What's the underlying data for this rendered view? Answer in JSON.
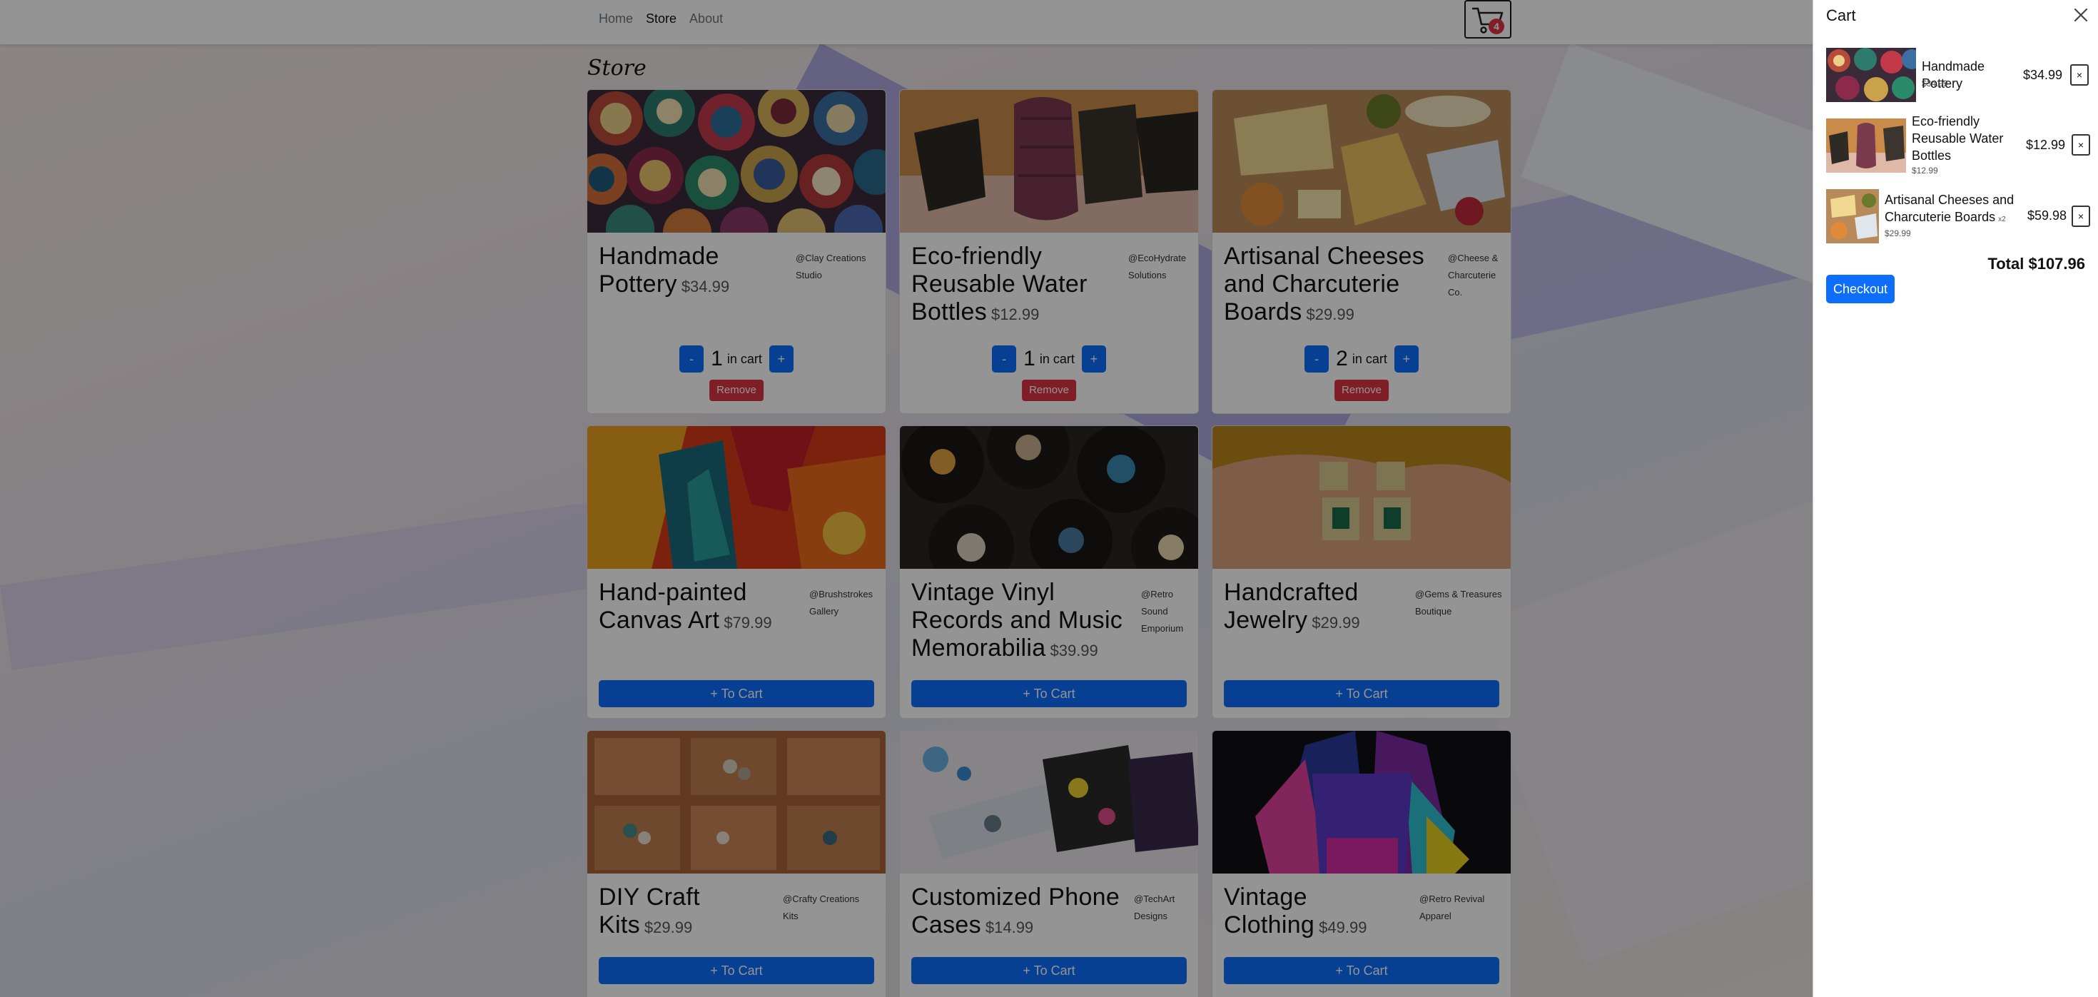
{
  "nav": {
    "links": [
      "Home",
      "Store",
      "About"
    ],
    "active": "Store",
    "cart_count": "4"
  },
  "store": {
    "title": "Store",
    "qty_suffix": "in cart",
    "remove_label": "Remove",
    "minus_label": "-",
    "plus_label": "+",
    "add_label": "+ To Cart",
    "products": [
      {
        "name": "Handmade Pottery",
        "price": "$34.99",
        "seller": "@Clay Creations Studio",
        "qty": "1"
      },
      {
        "name": "Eco-friendly Reusable Water Bottles",
        "price": "$12.99",
        "seller": "@EcoHydrate Solutions",
        "qty": "1"
      },
      {
        "name": "Artisanal Cheeses and Charcuterie Boards",
        "price": "$29.99",
        "seller": "@Cheese & Charcuterie Co.",
        "qty": "2"
      },
      {
        "name": "Hand-painted Canvas Art",
        "price": "$79.99",
        "seller": "@Brushstrokes Gallery",
        "qty": ""
      },
      {
        "name": "Vintage Vinyl Records and Music Memorabilia",
        "price": "$39.99",
        "seller": "@Retro Sound Emporium",
        "qty": ""
      },
      {
        "name": "Handcrafted Jewelry",
        "price": "$29.99",
        "seller": "@Gems & Treasures Boutique",
        "qty": ""
      },
      {
        "name": "DIY Craft Kits",
        "price": "$29.99",
        "seller": "@Crafty Creations Kits",
        "qty": ""
      },
      {
        "name": "Customized Phone Cases",
        "price": "$14.99",
        "seller": "@TechArt Designs",
        "qty": ""
      },
      {
        "name": "Vintage Clothing",
        "price": "$49.99",
        "seller": "@Retro Revival Apparel",
        "qty": ""
      }
    ]
  },
  "cart": {
    "title": "Cart",
    "close_label": "×",
    "remove_label": "×",
    "items": [
      {
        "name": "Handmade Pottery",
        "unit_price": "$34.99",
        "total": "$34.99",
        "qty_badge": ""
      },
      {
        "name": "Eco-friendly Reusable Water Bottles",
        "unit_price": "$12.99",
        "total": "$12.99",
        "qty_badge": ""
      },
      {
        "name": "Artisanal Cheeses and Charcuterie Boards",
        "unit_price": "$29.99",
        "total": "$59.98",
        "qty_badge": "x2"
      }
    ],
    "total_label": "Total $107.96",
    "checkout_label": "Checkout"
  },
  "colors": {
    "primary": "#0d6efd",
    "danger": "#dc3545"
  }
}
